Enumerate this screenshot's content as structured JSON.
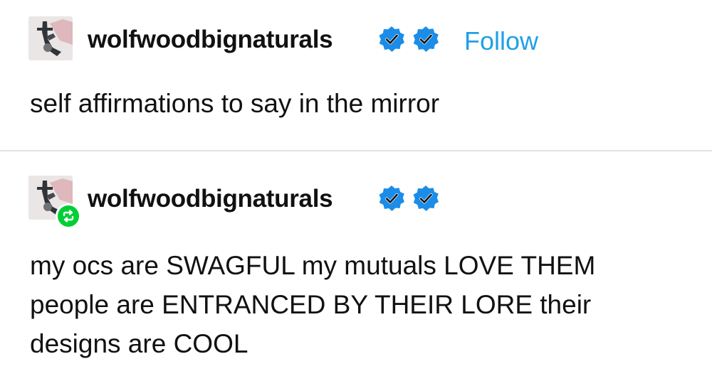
{
  "posts": [
    {
      "username": "wolfwoodbignaturals",
      "follow_label": "Follow",
      "badges": [
        "verified-icon",
        "verified-icon"
      ],
      "text": "self affirmations to say in the mirror"
    },
    {
      "username": "wolfwoodbignaturals",
      "badges": [
        "verified-icon",
        "verified-icon"
      ],
      "reblog_icon": "reblog-icon",
      "text_lines": [
        "my ocs are SWAGFUL my mutuals LOVE THEM",
        "people are ENTRANCED BY THEIR LORE their",
        "designs are COOL"
      ]
    }
  ],
  "colors": {
    "accent": "#1fa0e8",
    "badge_blue": "#1b8de8",
    "reblog_green": "#00cf35",
    "divider": "#e2e2e2"
  }
}
